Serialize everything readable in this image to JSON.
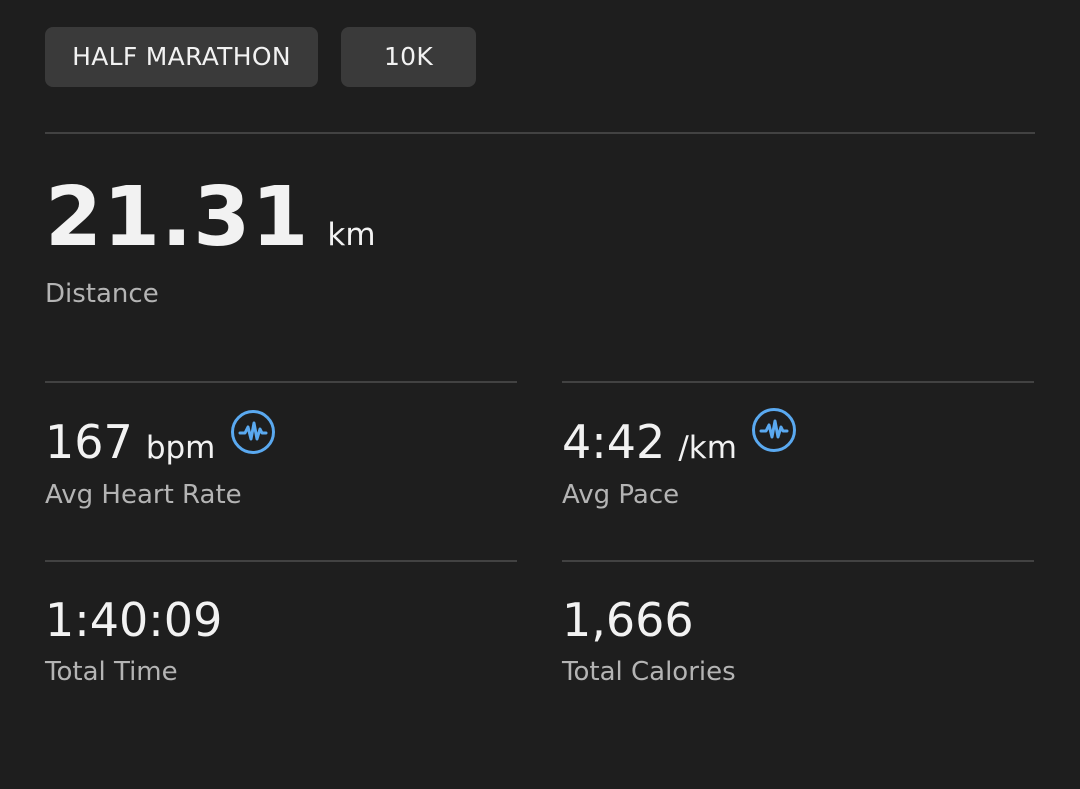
{
  "tabs": [
    {
      "label": "HALF MARATHON"
    },
    {
      "label": "10K"
    }
  ],
  "distance": {
    "value": "21.31",
    "unit": "km",
    "label": "Distance"
  },
  "heart_rate": {
    "value": "167",
    "unit": "bpm",
    "label": "Avg Heart Rate",
    "icon": "heart-rate-icon"
  },
  "pace": {
    "value": "4:42",
    "unit": "/km",
    "label": "Avg Pace",
    "icon": "heart-rate-icon"
  },
  "total_time": {
    "value": "1:40:09",
    "label": "Total Time"
  },
  "calories": {
    "value": "1,666",
    "label": "Total Calories"
  },
  "colors": {
    "background": "#1e1e1e",
    "chip": "#3a3a3a",
    "accent": "#5aa9f0",
    "label": "#b4b4b4"
  }
}
